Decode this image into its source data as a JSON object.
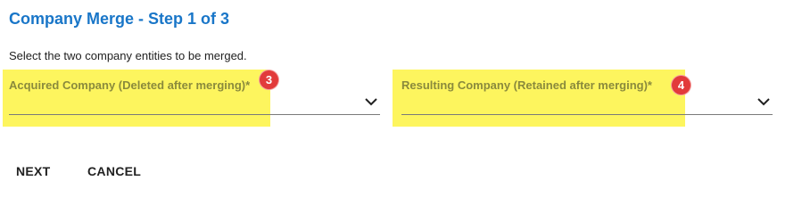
{
  "page": {
    "title": "Company Merge - Step 1 of 3",
    "instructions": "Select the two company entities to be merged."
  },
  "form": {
    "acquired": {
      "label": "Acquired Company (Deleted after merging)*",
      "value": "",
      "badge": "3"
    },
    "resulting": {
      "label": "Resulting Company (Retained after merging)*",
      "value": "",
      "badge": "4"
    }
  },
  "actions": {
    "next_label": "NEXT",
    "cancel_label": "CANCEL"
  },
  "colors": {
    "title": "#1976c8",
    "highlight": "#fdf55e",
    "badge": "#e23b3b"
  },
  "icons": {
    "dropdown": "chevron-down-icon"
  }
}
